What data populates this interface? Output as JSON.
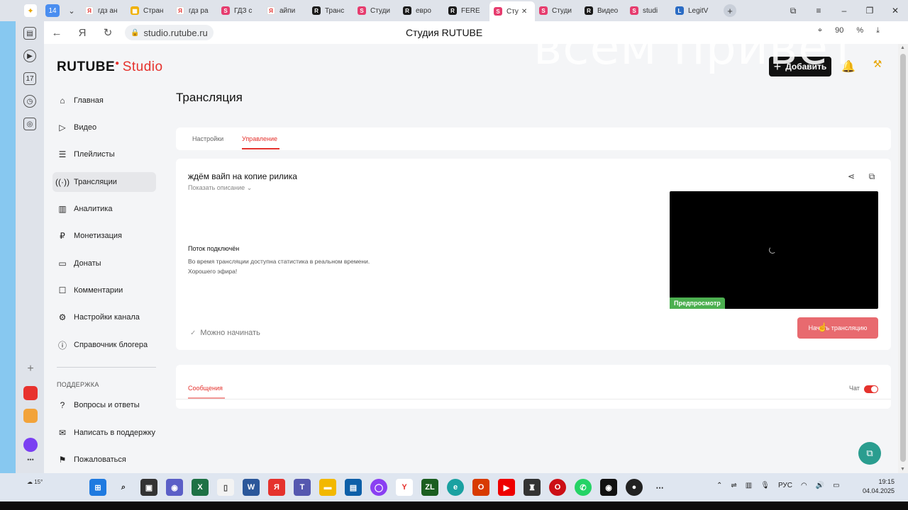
{
  "browser": {
    "tab_count": "14",
    "tabs": [
      {
        "label": "гдз ан",
        "icon": "yandex-icon"
      },
      {
        "label": "Стран",
        "icon": "spreadsheet-icon"
      },
      {
        "label": "гдз ра",
        "icon": "yandex-icon"
      },
      {
        "label": "ГДЗ с",
        "icon": "studio-icon"
      },
      {
        "label": "айпи",
        "icon": "yandex-icon"
      },
      {
        "label": "Транс",
        "icon": "rutube-icon"
      },
      {
        "label": "Студи",
        "icon": "studio-icon"
      },
      {
        "label": "евро",
        "icon": "rutube-icon"
      },
      {
        "label": "FERE",
        "icon": "rutube-icon"
      },
      {
        "label": "Сту",
        "icon": "studio-icon",
        "active": true
      },
      {
        "label": "Студи",
        "icon": "studio-icon"
      },
      {
        "label": "Видео",
        "icon": "rutube-icon"
      },
      {
        "label": "studi",
        "icon": "studio-icon"
      },
      {
        "label": "LegitV",
        "icon": "legit-icon"
      }
    ],
    "url": "studio.rutube.ru",
    "page_title": "Студия RUTUBE",
    "overlay_text": "всем привет",
    "addr_extra": "90"
  },
  "header": {
    "logo_main": "RUTUBE",
    "logo_studio": "Studio",
    "add_button": "Добавить"
  },
  "sidebar": {
    "items": [
      {
        "label": "Главная",
        "icon": "home-icon"
      },
      {
        "label": "Видео",
        "icon": "video-icon"
      },
      {
        "label": "Плейлисты",
        "icon": "playlist-icon"
      },
      {
        "label": "Трансляции",
        "icon": "broadcast-icon",
        "active": true
      },
      {
        "label": "Аналитика",
        "icon": "analytics-icon"
      },
      {
        "label": "Монетизация",
        "icon": "ruble-icon"
      },
      {
        "label": "Донаты",
        "icon": "wallet-icon"
      },
      {
        "label": "Комментарии",
        "icon": "comment-icon"
      },
      {
        "label": "Настройки канала",
        "icon": "gear-icon"
      },
      {
        "label": "Справочник блогера",
        "icon": "info-icon"
      }
    ],
    "support_heading": "ПОДДЕРЖКА",
    "support_items": [
      {
        "label": "Вопросы и ответы",
        "icon": "question-icon"
      },
      {
        "label": "Написать в поддержку",
        "icon": "mail-icon"
      },
      {
        "label": "Пожаловаться",
        "icon": "flag-icon"
      }
    ]
  },
  "main": {
    "heading": "Трансляция",
    "tabs": [
      {
        "label": "Настройки"
      },
      {
        "label": "Управление",
        "active": true
      }
    ],
    "stream": {
      "title": "ждём вайп на копие рилика",
      "show_description": "Показать описание",
      "status_title": "Поток подключён",
      "status_line1": "Во время трансляции доступна статистика в реальном времени.",
      "status_line2": "Хорошего эфира!",
      "preview_badge": "Предпросмотр",
      "ready_text": "Можно начинать",
      "start_button": "Начать трансляцию"
    },
    "messages": {
      "tab": "Сообщения",
      "chat_label": "Чат",
      "chat_enabled": true
    }
  },
  "taskbar": {
    "weather": "15°",
    "lang": "РУС",
    "time": "19:15",
    "date": "04.04.2025"
  },
  "colors": {
    "accent": "#e5322d",
    "start_button": "#e86a6f",
    "preview_badge": "#4caf50",
    "help_fab": "#2a9d8f"
  }
}
